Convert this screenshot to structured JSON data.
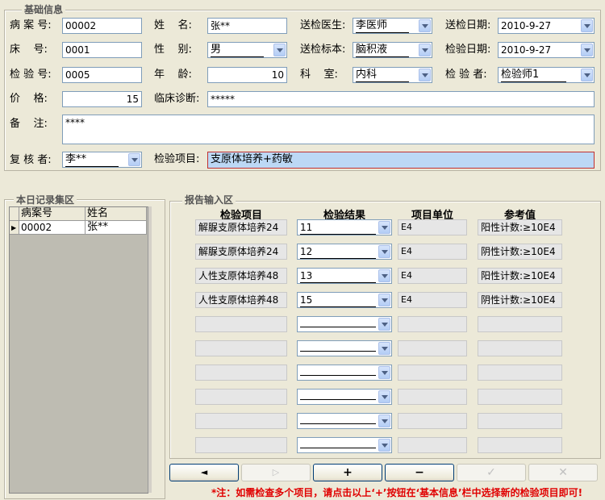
{
  "basic": {
    "legend": "基础信息",
    "case_no_label": "病 案 号:",
    "case_no": "00002",
    "bed_label": "床    号:",
    "bed": "0001",
    "test_no_label": "检 验 号:",
    "test_no": "0005",
    "price_label": "价    格:",
    "price": "15",
    "remark_label": "备    注:",
    "remark": "****",
    "reviewer_label": "复 核 者:",
    "reviewer": "李**",
    "name_label": "姓    名:",
    "name": "张**",
    "gender_label": "性    别:",
    "gender": "男",
    "age_label": "年    龄:",
    "age": "10",
    "diagnosis_label": "临床诊断:",
    "diagnosis": "*****",
    "items_label": "检验项目:",
    "items": "支原体培养+药敏",
    "doctor_label": "送检医生:",
    "doctor": "李医师",
    "specimen_label": "送检标本:",
    "specimen": "脑积液",
    "dept_label": "科    室:",
    "dept": "内科",
    "send_date_label": "送检日期:",
    "send_date": "2010-9-27",
    "test_date_label": "检验日期:",
    "test_date": "2010-9-27",
    "tester_label": "检 验 者:",
    "tester": "检验师1"
  },
  "today": {
    "legend": "本日记录集区",
    "columns": [
      "病案号",
      "姓名"
    ],
    "rows": [
      [
        "00002",
        "张**"
      ]
    ]
  },
  "report": {
    "legend": "报告输入区",
    "columns": [
      "检验项目",
      "检验结果",
      "项目单位",
      "参考值"
    ],
    "rows": [
      [
        "解脲支原体培养24",
        "11",
        "E4",
        "阳性计数:≥10E4"
      ],
      [
        "解脲支原体培养24",
        "12",
        "E4",
        "阴性计数:≥10E4"
      ],
      [
        "人性支原体培养48",
        "13",
        "E4",
        "阳性计数:≥10E4"
      ],
      [
        "人性支原体培养48",
        "15",
        "E4",
        "阴性计数:≥10E4"
      ],
      [
        "",
        "",
        "",
        ""
      ],
      [
        "",
        "",
        "",
        ""
      ],
      [
        "",
        "",
        "",
        ""
      ],
      [
        "",
        "",
        "",
        ""
      ],
      [
        "",
        "",
        "",
        ""
      ],
      [
        "",
        "",
        "",
        ""
      ]
    ],
    "buttons": [
      "◄",
      "▷",
      "+",
      "−",
      "✓",
      "✕"
    ],
    "note": "*注：如需检查多个项目，请点击以上‘+’按钮在‘基本信息’栏中选择新的检验项目即可!"
  }
}
